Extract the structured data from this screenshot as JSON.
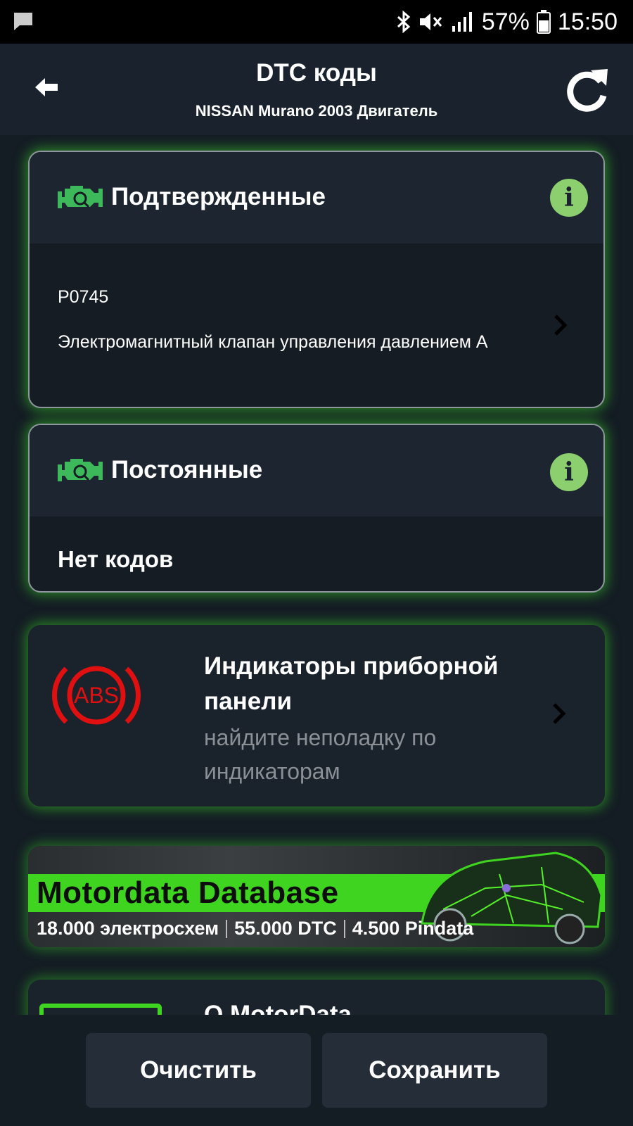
{
  "status_bar": {
    "battery": "57%",
    "time": "15:50",
    "icons": [
      "message-icon",
      "bluetooth-icon",
      "mute-icon",
      "signal-icon",
      "battery-icon"
    ]
  },
  "header": {
    "title": "DTC коды",
    "subtitle": "NISSAN Murano 2003 Двигатель",
    "back_icon": "arrow-left-icon",
    "refresh_icon": "refresh-icon"
  },
  "confirmed": {
    "title": "Подтвержденные",
    "info_label": "i",
    "code": "P0745",
    "description": "Электромагнитный клапан управления давлением А"
  },
  "permanent": {
    "title": "Постоянные",
    "info_label": "i",
    "empty_text": "Нет кодов"
  },
  "indicators": {
    "icon_label": "ABS",
    "title": "Индикаторы приборной панели",
    "subtitle": "найдите неполадку по индикаторам"
  },
  "banner": {
    "title": "Motordata Database",
    "stat1": "18.000 электросхем",
    "stat2": "55.000 DTC",
    "stat3": "4.500 Pindata"
  },
  "about": {
    "title": "О MotorData"
  },
  "buttons": {
    "clear": "Очистить",
    "save": "Сохранить"
  },
  "colors": {
    "background": "#141c24",
    "accent_green": "#3ed41f",
    "info_green": "#8ccf6e",
    "abs_red": "#e01010"
  }
}
